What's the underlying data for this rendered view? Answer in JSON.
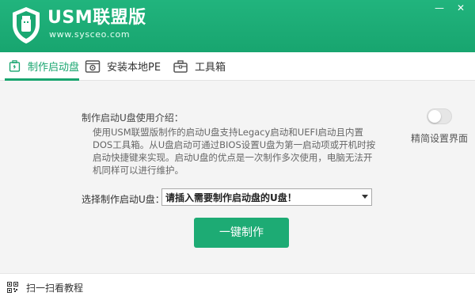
{
  "app": {
    "title": "USM联盟版",
    "url": "www.sysceo.com",
    "brand_color": "#18a56f"
  },
  "window": {
    "minimize_icon": "minimize-icon",
    "minimize_glyph": "—",
    "close_icon": "close-icon",
    "close_glyph": "✕"
  },
  "tabs": [
    {
      "label": "制作启动盘",
      "icon": "usb-drive-icon",
      "active": true
    },
    {
      "label": "安装本地PE",
      "icon": "gear-box-icon",
      "active": false
    },
    {
      "label": "工具箱",
      "icon": "toolbox-icon",
      "active": false
    }
  ],
  "main": {
    "intro_title": "制作启动U盘使用介绍：",
    "intro_text": "使用USM联盟版制作的启动U盘支持Legacy启动和UEFI启动且内置DOS工具箱。从U盘启动可通过BIOS设置U盘为第一启动项或开机时按启动快捷键来实现。启动U盘的优点是一次制作多次使用，电脑无法开机同样可以进行维护。",
    "toggle_label": "精简设置界面",
    "toggle_on": false,
    "select_label": "选择制作启动U盘：",
    "select_value": "请插入需要制作启动盘的U盘！",
    "primary_button": "一键制作"
  },
  "footer": {
    "qr_icon": "qr-code-icon",
    "text": "扫一扫看教程"
  }
}
